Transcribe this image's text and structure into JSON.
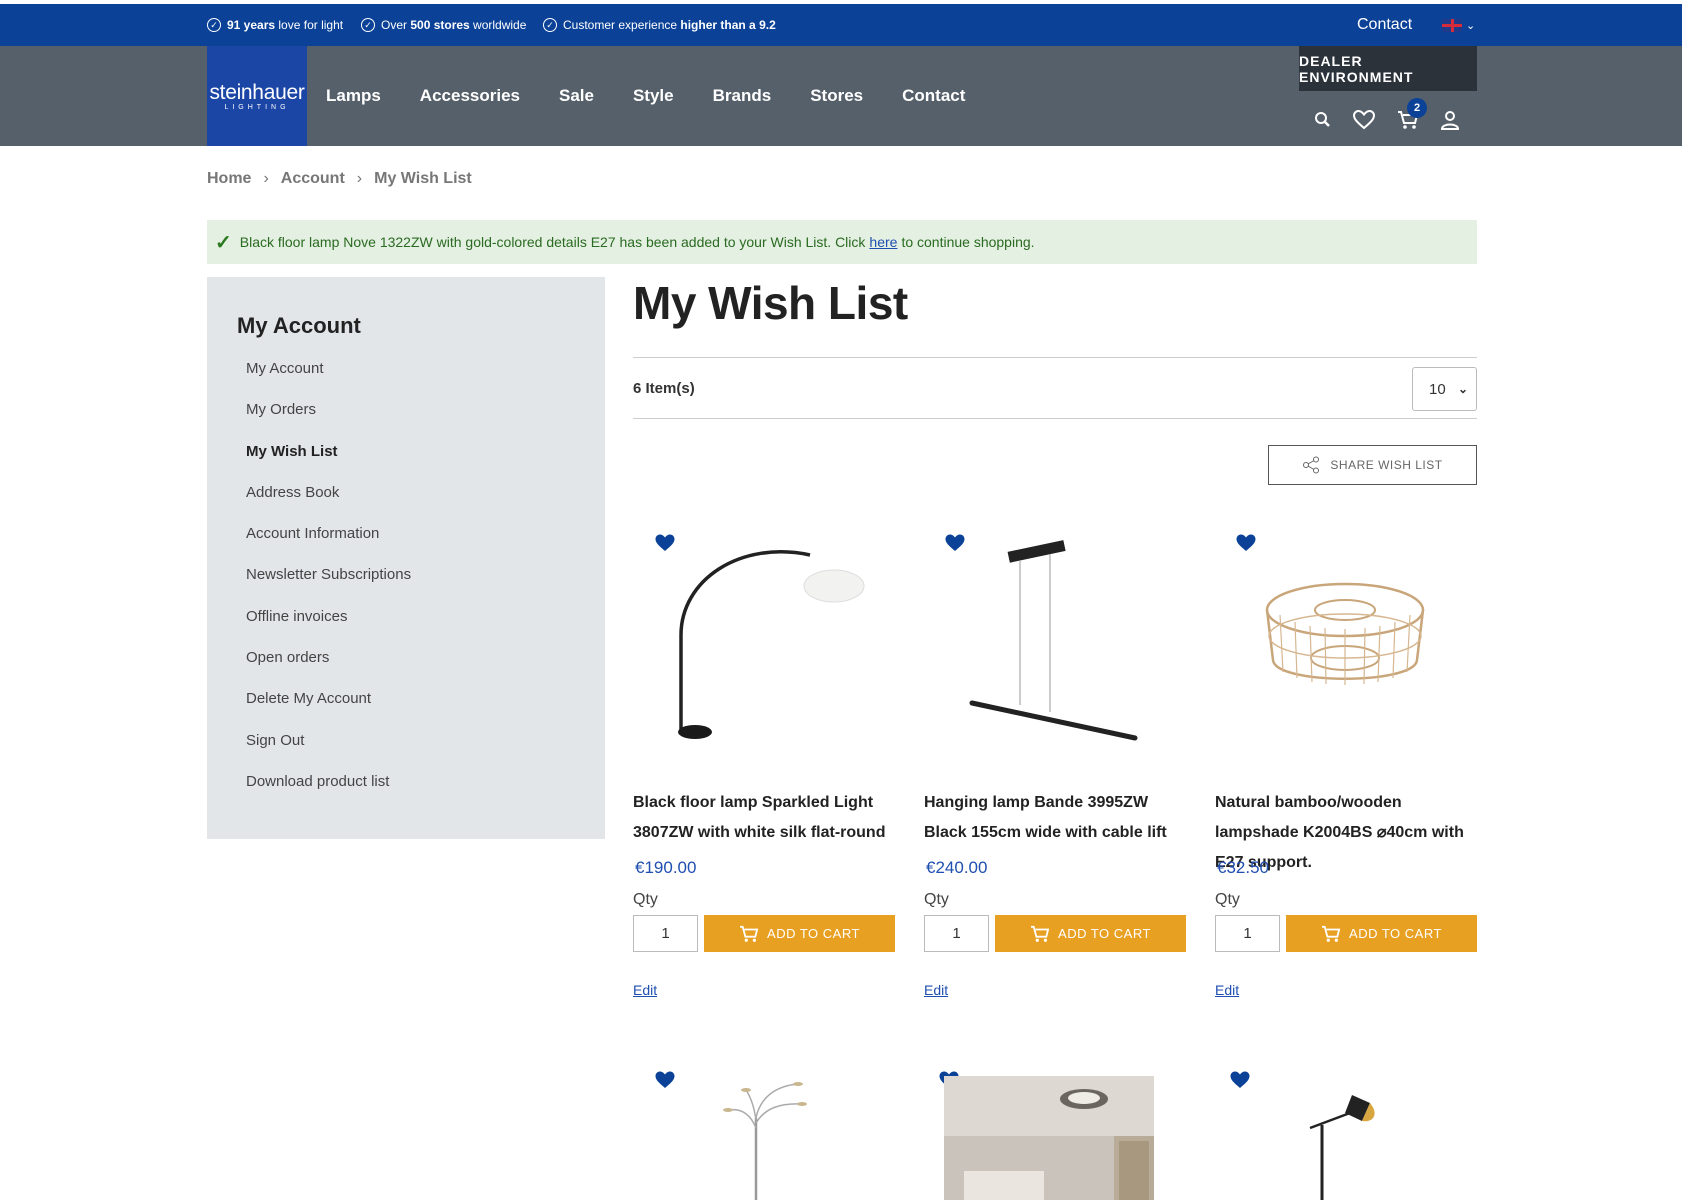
{
  "usps": [
    {
      "bold": "91 years",
      "text": " love for light"
    },
    {
      "pre": "Over ",
      "bold": "500 stores",
      "text": " worldwide"
    },
    {
      "pre": "Customer experience ",
      "bold": "higher than a 9.2",
      "text": ""
    }
  ],
  "topbar": {
    "contact": "Contact"
  },
  "logo": {
    "name": "steinhauer",
    "sub": "LIGHTING"
  },
  "nav": [
    "Lamps",
    "Accessories",
    "Sale",
    "Style",
    "Brands",
    "Stores",
    "Contact"
  ],
  "dealer": "DEALER ENVIRONMENT",
  "cart_count": "2",
  "breadcrumb": [
    "Home",
    "Account",
    "My Wish List"
  ],
  "message": {
    "text": "Black floor lamp Nove 1322ZW with gold-colored details E27 has been added to your Wish List. Click",
    "link": "here",
    "after": "to continue shopping."
  },
  "sidebar": {
    "title": "My Account",
    "items": [
      "My Account",
      "My Orders",
      "My Wish List",
      "Address Book",
      "Account Information",
      "Newsletter Subscriptions",
      "Offline invoices",
      "Open orders",
      "Delete My Account",
      "Sign Out",
      "Download product list"
    ],
    "active": "My Wish List"
  },
  "page_title": "My Wish List",
  "count": "6 Item(s)",
  "limiter": "10",
  "share": "SHARE WISH LIST",
  "products": [
    {
      "name": "Black floor lamp Sparkled Light 3807ZW with white silk flat-round",
      "price": "€190.00",
      "qty_label": "Qty",
      "qty": "1",
      "cart": "ADD TO CART",
      "edit": "Edit"
    },
    {
      "name": "Hanging lamp Bande 3995ZW Black 155cm wide with cable lift",
      "price": "€240.00",
      "qty_label": "Qty",
      "qty": "1",
      "cart": "ADD TO CART",
      "edit": "Edit"
    },
    {
      "name": "Natural bamboo/wooden lampshade K2004BS ⌀40cm with E27 support.",
      "price": "€32.50",
      "qty_label": "Qty",
      "qty": "1",
      "cart": "ADD TO CART",
      "edit": "Edit"
    }
  ],
  "colors": {
    "brand_blue": "#0b4298",
    "header_gray": "#56606a",
    "cart_orange": "#e8a022",
    "success_bg": "#e4f0e1"
  }
}
